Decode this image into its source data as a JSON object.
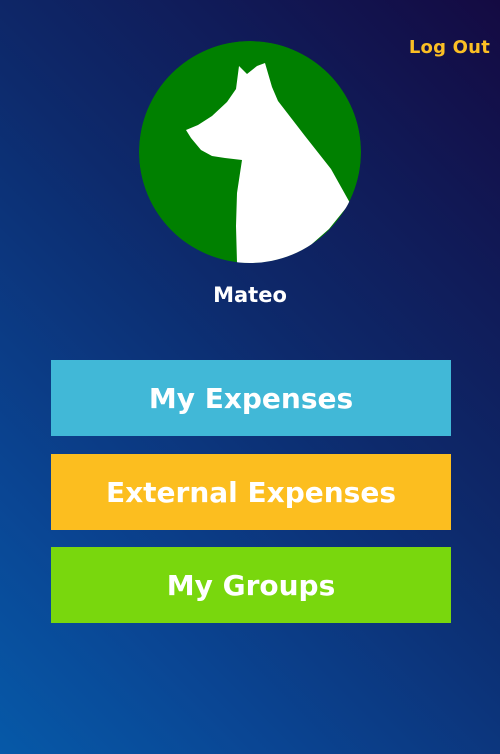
{
  "header": {
    "logout_label": "Log Out"
  },
  "profile": {
    "avatar_icon": "dog-silhouette-icon",
    "avatar_bg": "#008000",
    "username": "Mateo"
  },
  "menu": {
    "items": [
      {
        "label": "My Expenses",
        "color": "#41b8d7"
      },
      {
        "label": "External Expenses",
        "color": "#fcbe1f"
      },
      {
        "label": "My Groups",
        "color": "#79d70d"
      }
    ]
  },
  "colors": {
    "accent": "#fbbf24"
  }
}
